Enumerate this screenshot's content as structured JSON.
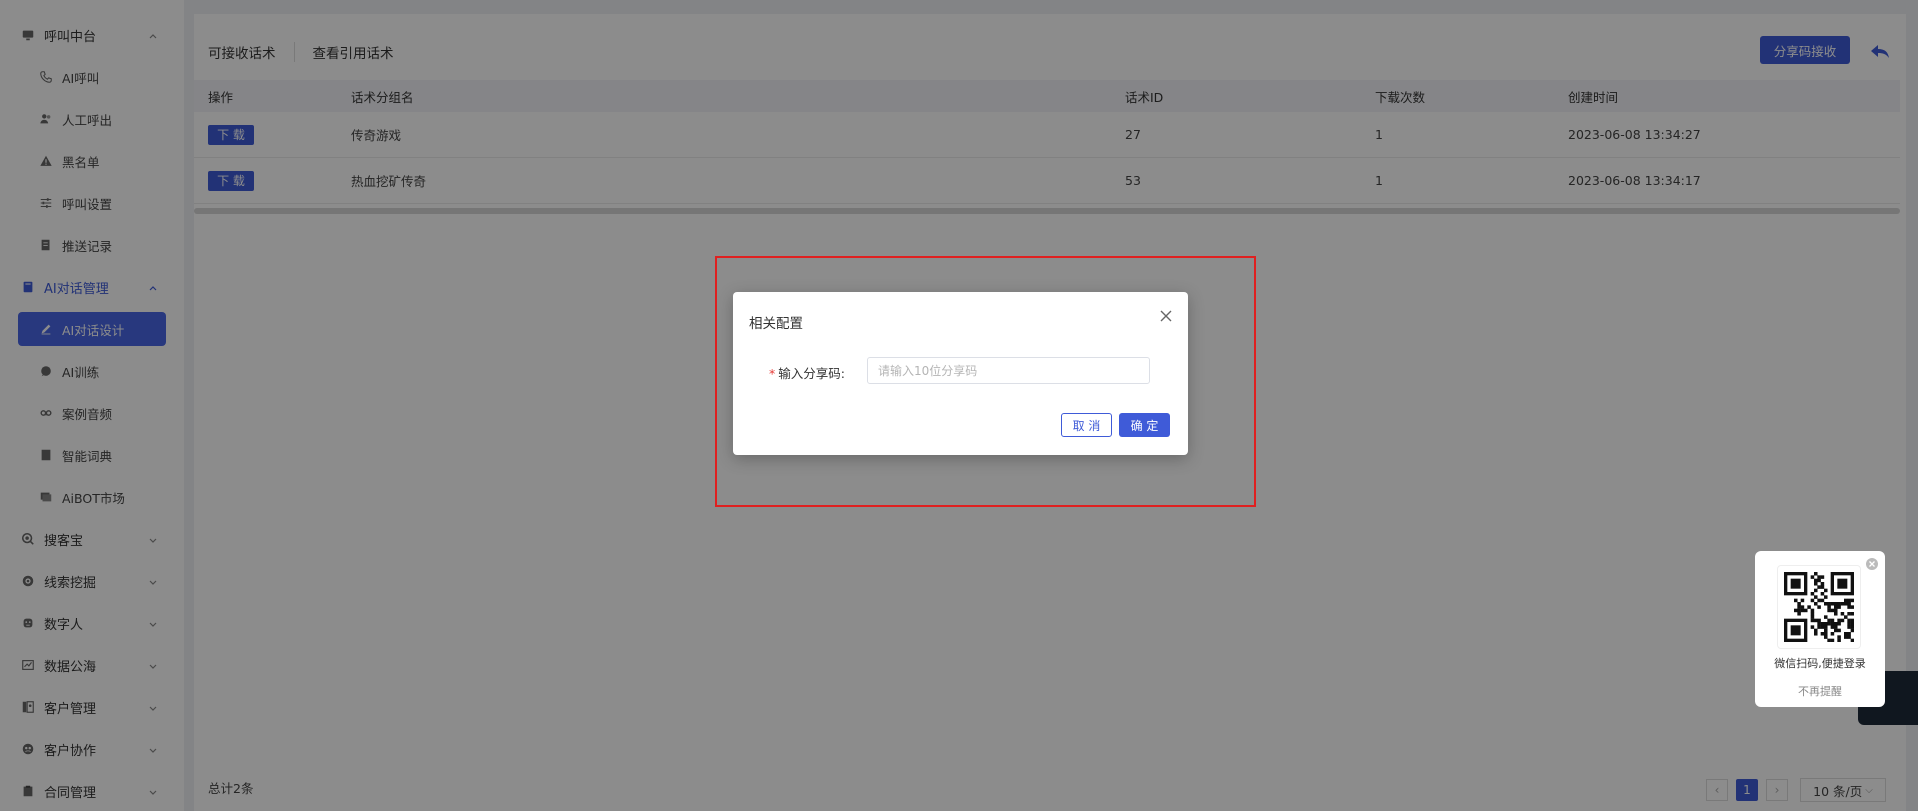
{
  "sidebar": {
    "items": [
      {
        "label": "呼叫中台",
        "type": "group",
        "icon": "monitor-icon",
        "chevron": "up"
      },
      {
        "label": "AI呼叫",
        "type": "child",
        "icon": "phone-icon"
      },
      {
        "label": "人工呼出",
        "type": "child",
        "icon": "users-icon"
      },
      {
        "label": "黑名单",
        "type": "child",
        "icon": "warning-icon"
      },
      {
        "label": "呼叫设置",
        "type": "child",
        "icon": "sliders-icon"
      },
      {
        "label": "推送记录",
        "type": "child",
        "icon": "doc-icon"
      },
      {
        "label": "AI对话管理",
        "type": "group",
        "icon": "book-icon",
        "chevron": "up",
        "active": true
      },
      {
        "label": "AI对话设计",
        "type": "child",
        "icon": "pen-icon",
        "active": true
      },
      {
        "label": "AI训练",
        "type": "child",
        "icon": "chat-icon"
      },
      {
        "label": "案例音频",
        "type": "child",
        "icon": "tape-icon"
      },
      {
        "label": "智能词典",
        "type": "child",
        "icon": "dictionary-icon"
      },
      {
        "label": "AiBOT市场",
        "type": "child",
        "icon": "screen-icon"
      },
      {
        "label": "搜客宝",
        "type": "group",
        "icon": "search-icon",
        "chevron": "down"
      },
      {
        "label": "线索挖掘",
        "type": "group",
        "icon": "target-icon",
        "chevron": "down"
      },
      {
        "label": "数字人",
        "type": "group",
        "icon": "robot-icon",
        "chevron": "down"
      },
      {
        "label": "数据公海",
        "type": "group",
        "icon": "chart-icon",
        "chevron": "down"
      },
      {
        "label": "客户管理",
        "type": "group",
        "icon": "contacts-icon",
        "chevron": "down"
      },
      {
        "label": "客户协作",
        "type": "group",
        "icon": "cooperate-icon",
        "chevron": "down"
      },
      {
        "label": "合同管理",
        "type": "group",
        "icon": "clipboard-icon",
        "chevron": "down"
      }
    ]
  },
  "header": {
    "tabs": [
      "可接收话术",
      "查看引用话术"
    ],
    "share_button": "分享码接收"
  },
  "table": {
    "columns": [
      "操作",
      "话术分组名",
      "话术ID",
      "下载次数",
      "创建时间"
    ],
    "download_label": "下 载",
    "rows": [
      {
        "name": "传奇游戏",
        "id": "27",
        "downloads": "1",
        "created": "2023-06-08 13:34:27"
      },
      {
        "name": "热血挖矿传奇",
        "id": "53",
        "downloads": "1",
        "created": "2023-06-08 13:34:17"
      }
    ]
  },
  "footer": {
    "total": "总计2条",
    "page": "1",
    "page_size": "10 条/页"
  },
  "dialog": {
    "title": "相关配置",
    "field_label": "输入分享码:",
    "field_placeholder": "请输入10位分享码",
    "field_value": "",
    "cancel": "取 消",
    "confirm": "确 定"
  },
  "qr_popup": {
    "caption": "微信扫码,便捷登录",
    "dismiss": "不再提醒"
  },
  "colors": {
    "accent": "#3f5bd8",
    "highlight": "#e02020"
  }
}
